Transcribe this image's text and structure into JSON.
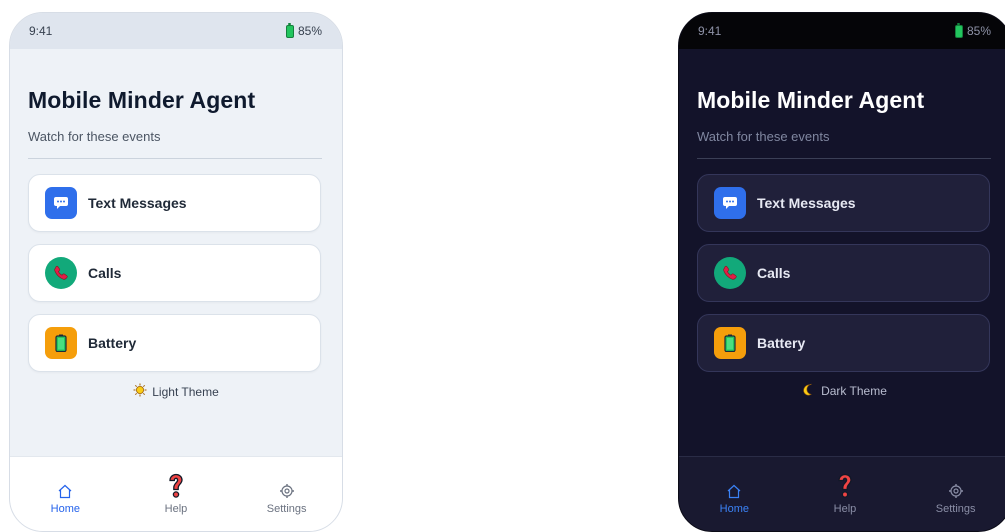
{
  "light": {
    "status": {
      "time": "9:41",
      "battery": "85%"
    },
    "title": "Mobile Minder Agent",
    "subtitle": "Watch for these events",
    "items": [
      {
        "label": "Text Messages",
        "icon": "message-icon"
      },
      {
        "label": "Calls",
        "icon": "phone-icon"
      },
      {
        "label": "Battery",
        "icon": "battery-icon"
      }
    ],
    "theme_label": "Light Theme",
    "theme_icon": "sun-icon",
    "nav": [
      {
        "label": "Home",
        "icon": "home-icon",
        "active": true
      },
      {
        "label": "Help",
        "icon": "question-icon",
        "active": false
      },
      {
        "label": "Settings",
        "icon": "gear-icon",
        "active": false
      }
    ]
  },
  "dark": {
    "status": {
      "time": "9:41",
      "battery": "85%"
    },
    "title": "Mobile Minder Agent",
    "subtitle": "Watch for these events",
    "items": [
      {
        "label": "Text Messages",
        "icon": "message-icon"
      },
      {
        "label": "Calls",
        "icon": "phone-icon"
      },
      {
        "label": "Battery",
        "icon": "battery-icon"
      }
    ],
    "theme_label": "Dark Theme",
    "theme_icon": "moon-icon",
    "nav": [
      {
        "label": "Home",
        "icon": "home-icon",
        "active": true
      },
      {
        "label": "Help",
        "icon": "question-icon",
        "active": false
      },
      {
        "label": "Settings",
        "icon": "gear-icon",
        "active": false
      }
    ]
  },
  "colors": {
    "message_icon_bg": "#2f6feb",
    "call_icon_bg": "#12a97a",
    "battery_icon_bg": "#f59e0b",
    "battery_green": "#22c55e",
    "active_nav": "#2563eb",
    "help_red": "#ef4444"
  }
}
